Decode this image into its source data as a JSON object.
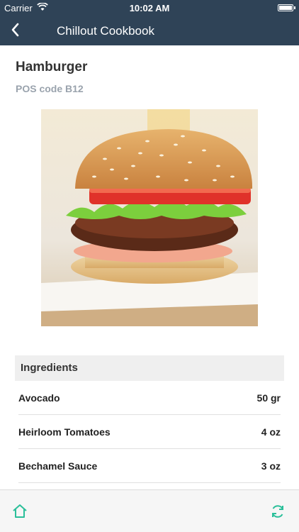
{
  "status": {
    "carrier": "Carrier",
    "time": "10:02 AM"
  },
  "nav": {
    "title": "Chillout Cookbook",
    "back_icon": "chevron-left-icon"
  },
  "dish": {
    "name": "Hamburger",
    "pos_code": "POS code B12"
  },
  "ingredients": {
    "header": "Ingredients",
    "items": [
      {
        "name": "Avocado",
        "qty": "50 gr"
      },
      {
        "name": "Heirloom Tomatoes",
        "qty": "4 oz"
      },
      {
        "name": "Bechamel Sauce",
        "qty": "3 oz"
      }
    ]
  },
  "tabbar": {
    "home_icon": "home-icon",
    "refresh_icon": "refresh-icon",
    "accent": "#2bbf9a"
  },
  "colors": {
    "nav_bg": "#2f4357"
  }
}
